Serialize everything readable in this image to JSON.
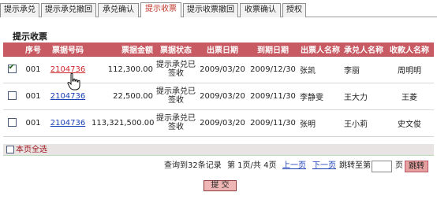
{
  "tabs": [
    {
      "label": "提示承兑"
    },
    {
      "label": "提示承兑撤回"
    },
    {
      "label": "承兑确认"
    },
    {
      "label": "提示收票"
    },
    {
      "label": "提示收票撤回"
    },
    {
      "label": "收票确认"
    },
    {
      "label": "授权"
    }
  ],
  "active_tab": "提示收票",
  "panel_title": "提示收票",
  "table": {
    "headers": [
      "序号",
      "票据号码",
      "票据金额",
      "票据状态",
      "出票日期",
      "到期日期",
      "出票人名称",
      "承兑人名称",
      "收款人名称"
    ],
    "rows": [
      {
        "checked": true,
        "seq": "001",
        "bill_no": "2104736",
        "amount": "112,300.00",
        "status": "提示承兑已签收",
        "issue_date": "2009/03/20",
        "due_date": "2009/12/30",
        "drawer": "张凯",
        "acceptor": "李丽",
        "payee": "周明明"
      },
      {
        "checked": false,
        "seq": "001",
        "bill_no": "2104736",
        "amount": "22,500.00",
        "status": "提示承兑已签收",
        "issue_date": "2009/03/20",
        "due_date": "2009/11/30",
        "drawer": "李静雯",
        "acceptor": "王大力",
        "payee": "王菱"
      },
      {
        "checked": false,
        "seq": "001",
        "bill_no": "2104736",
        "amount": "113,321,500.00",
        "status": "提示承兑已签收",
        "issue_date": "2009/03/20",
        "due_date": "2009/11/30",
        "drawer": "张明",
        "acceptor": "王小莉",
        "payee": "史文俊"
      }
    ]
  },
  "select_all_label": "本页全选",
  "pager": {
    "summary": "查询到32条记录",
    "page_info": "第 1页/共 4页",
    "prev": "上一页",
    "next": "下一页",
    "jump_to": "跳转至第",
    "page_suffix": "页",
    "jump_button": "跳转"
  },
  "submit_label": "提 交"
}
